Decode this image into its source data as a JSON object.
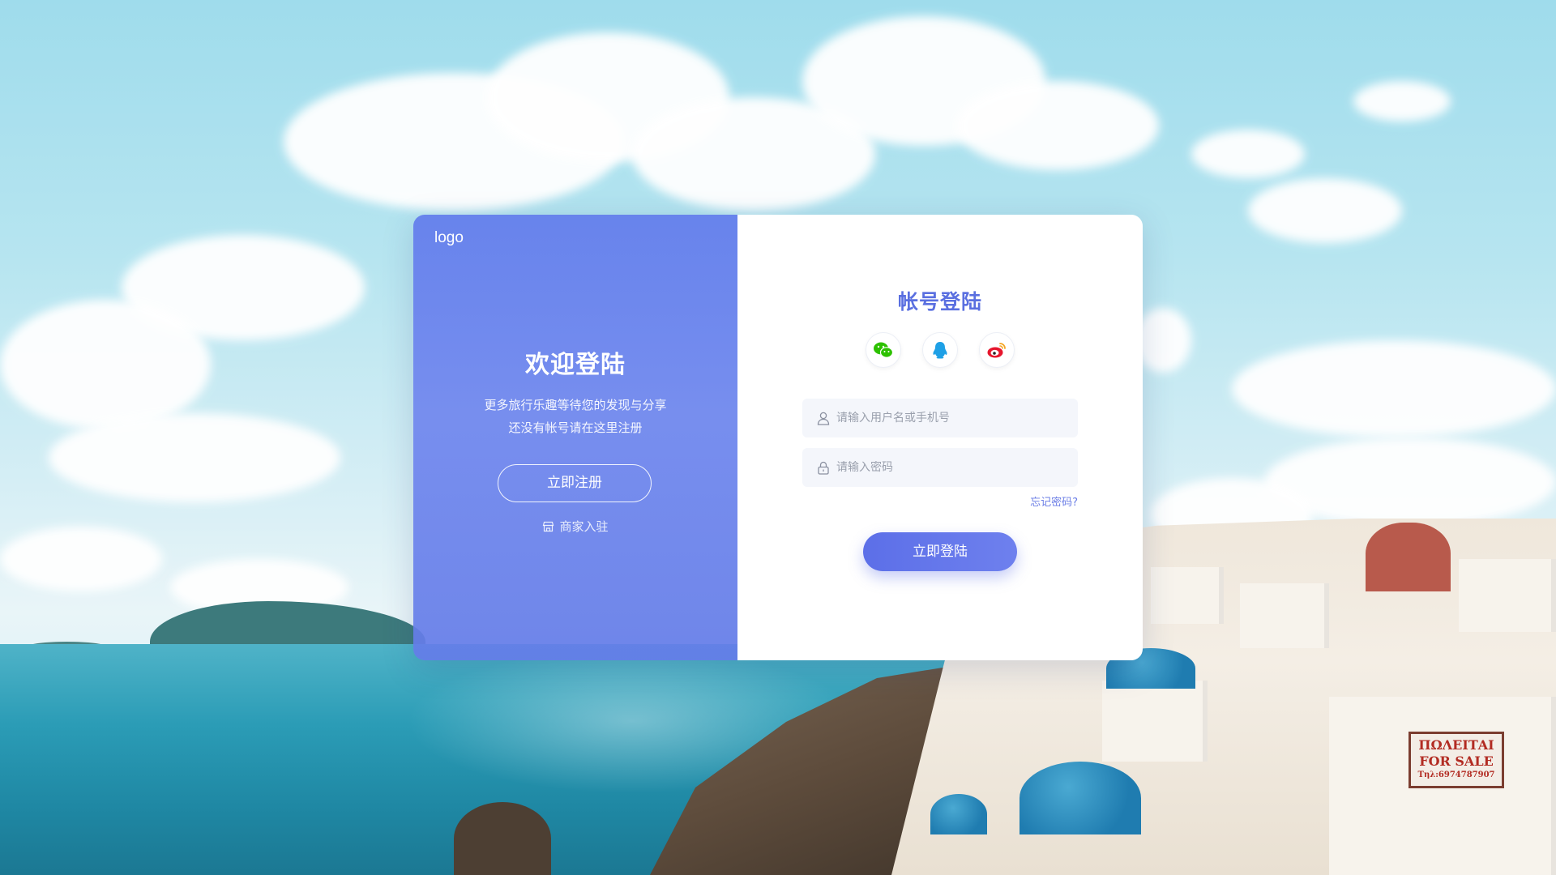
{
  "brand": {
    "logo_text": "logo"
  },
  "left_panel": {
    "heading": "欢迎登陆",
    "subtitle_line1": "更多旅行乐趣等待您的发现与分享",
    "subtitle_line2": "还没有帐号请在这里注册",
    "register_button": "立即注册",
    "merchant_link": "商家入驻",
    "merchant_icon": "store-icon"
  },
  "login_panel": {
    "title": "帐号登陆",
    "social_logins": [
      {
        "icon": "wechat-icon",
        "color": "#2dc100"
      },
      {
        "icon": "qq-icon",
        "color": "#1ea0e6"
      },
      {
        "icon": "weibo-icon",
        "color": "#e6162d"
      }
    ],
    "username": {
      "placeholder": "请输入用户名或手机号",
      "value": "",
      "icon": "user-icon"
    },
    "password": {
      "placeholder": "请输入密码",
      "value": "",
      "icon": "lock-icon"
    },
    "forgot_link": "忘记密码?",
    "login_button": "立即登陆"
  },
  "background": {
    "sign_line1": "ΠΩΛΕΙΤΑΙ",
    "sign_line2": "FOR SALE",
    "sign_line3": "Τηλ:6974787907"
  },
  "colors": {
    "accent": "#5c6fe8",
    "panel": "#6a80ea",
    "title": "#5a6fe0"
  }
}
